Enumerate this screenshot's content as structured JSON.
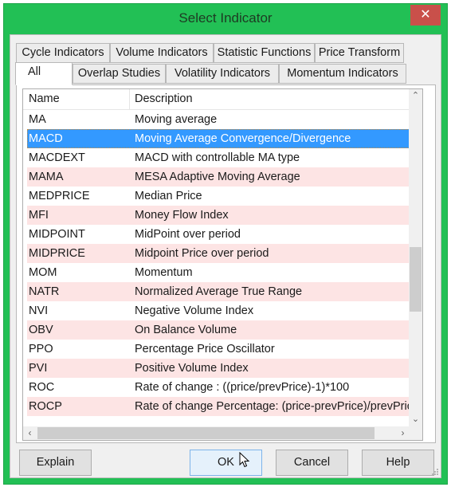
{
  "window": {
    "title": "Select Indicator",
    "close_label": "✕",
    "frame_color": "#22c055",
    "close_color": "#c9504a"
  },
  "tabs": {
    "row1": [
      {
        "label": "Cycle Indicators"
      },
      {
        "label": "Volume Indicators"
      },
      {
        "label": "Statistic Functions"
      },
      {
        "label": "Price Transform"
      }
    ],
    "row2": [
      {
        "label": "All",
        "active": true
      },
      {
        "label": "Overlap Studies"
      },
      {
        "label": "Volatility Indicators"
      },
      {
        "label": "Momentum Indicators"
      }
    ]
  },
  "list": {
    "columns": [
      "Name",
      "Description"
    ],
    "selected_color": "#3399ff",
    "alt_row_color": "#fde4e4",
    "rows": [
      {
        "name": "MA",
        "description": "Moving average",
        "style": ""
      },
      {
        "name": "MACD",
        "description": "Moving Average Convergence/Divergence",
        "style": "selected"
      },
      {
        "name": "MACDEXT",
        "description": "MACD with controllable MA type",
        "style": ""
      },
      {
        "name": "MAMA",
        "description": "MESA Adaptive Moving Average",
        "style": "alt"
      },
      {
        "name": "MEDPRICE",
        "description": "Median Price",
        "style": ""
      },
      {
        "name": "MFI",
        "description": "Money Flow Index",
        "style": "alt"
      },
      {
        "name": "MIDPOINT",
        "description": "MidPoint over period",
        "style": ""
      },
      {
        "name": "MIDPRICE",
        "description": "Midpoint Price over period",
        "style": "alt"
      },
      {
        "name": "MOM",
        "description": "Momentum",
        "style": ""
      },
      {
        "name": "NATR",
        "description": "Normalized Average True Range",
        "style": "alt"
      },
      {
        "name": "NVI",
        "description": "Negative Volume Index",
        "style": ""
      },
      {
        "name": "OBV",
        "description": "On Balance Volume",
        "style": "alt"
      },
      {
        "name": "PPO",
        "description": "Percentage Price Oscillator",
        "style": ""
      },
      {
        "name": "PVI",
        "description": "Positive Volume Index",
        "style": "alt"
      },
      {
        "name": "ROC",
        "description": "Rate of change : ((price/prevPrice)-1)*100",
        "style": ""
      },
      {
        "name": "ROCP",
        "description": "Rate of change Percentage: (price-prevPrice)/prevPrice",
        "style": "alt"
      }
    ],
    "scroll": {
      "up": "⌃",
      "down": "⌄",
      "left": "‹",
      "right": "›"
    }
  },
  "buttons": {
    "explain": "Explain",
    "ok": "OK",
    "cancel": "Cancel",
    "help": "Help"
  }
}
